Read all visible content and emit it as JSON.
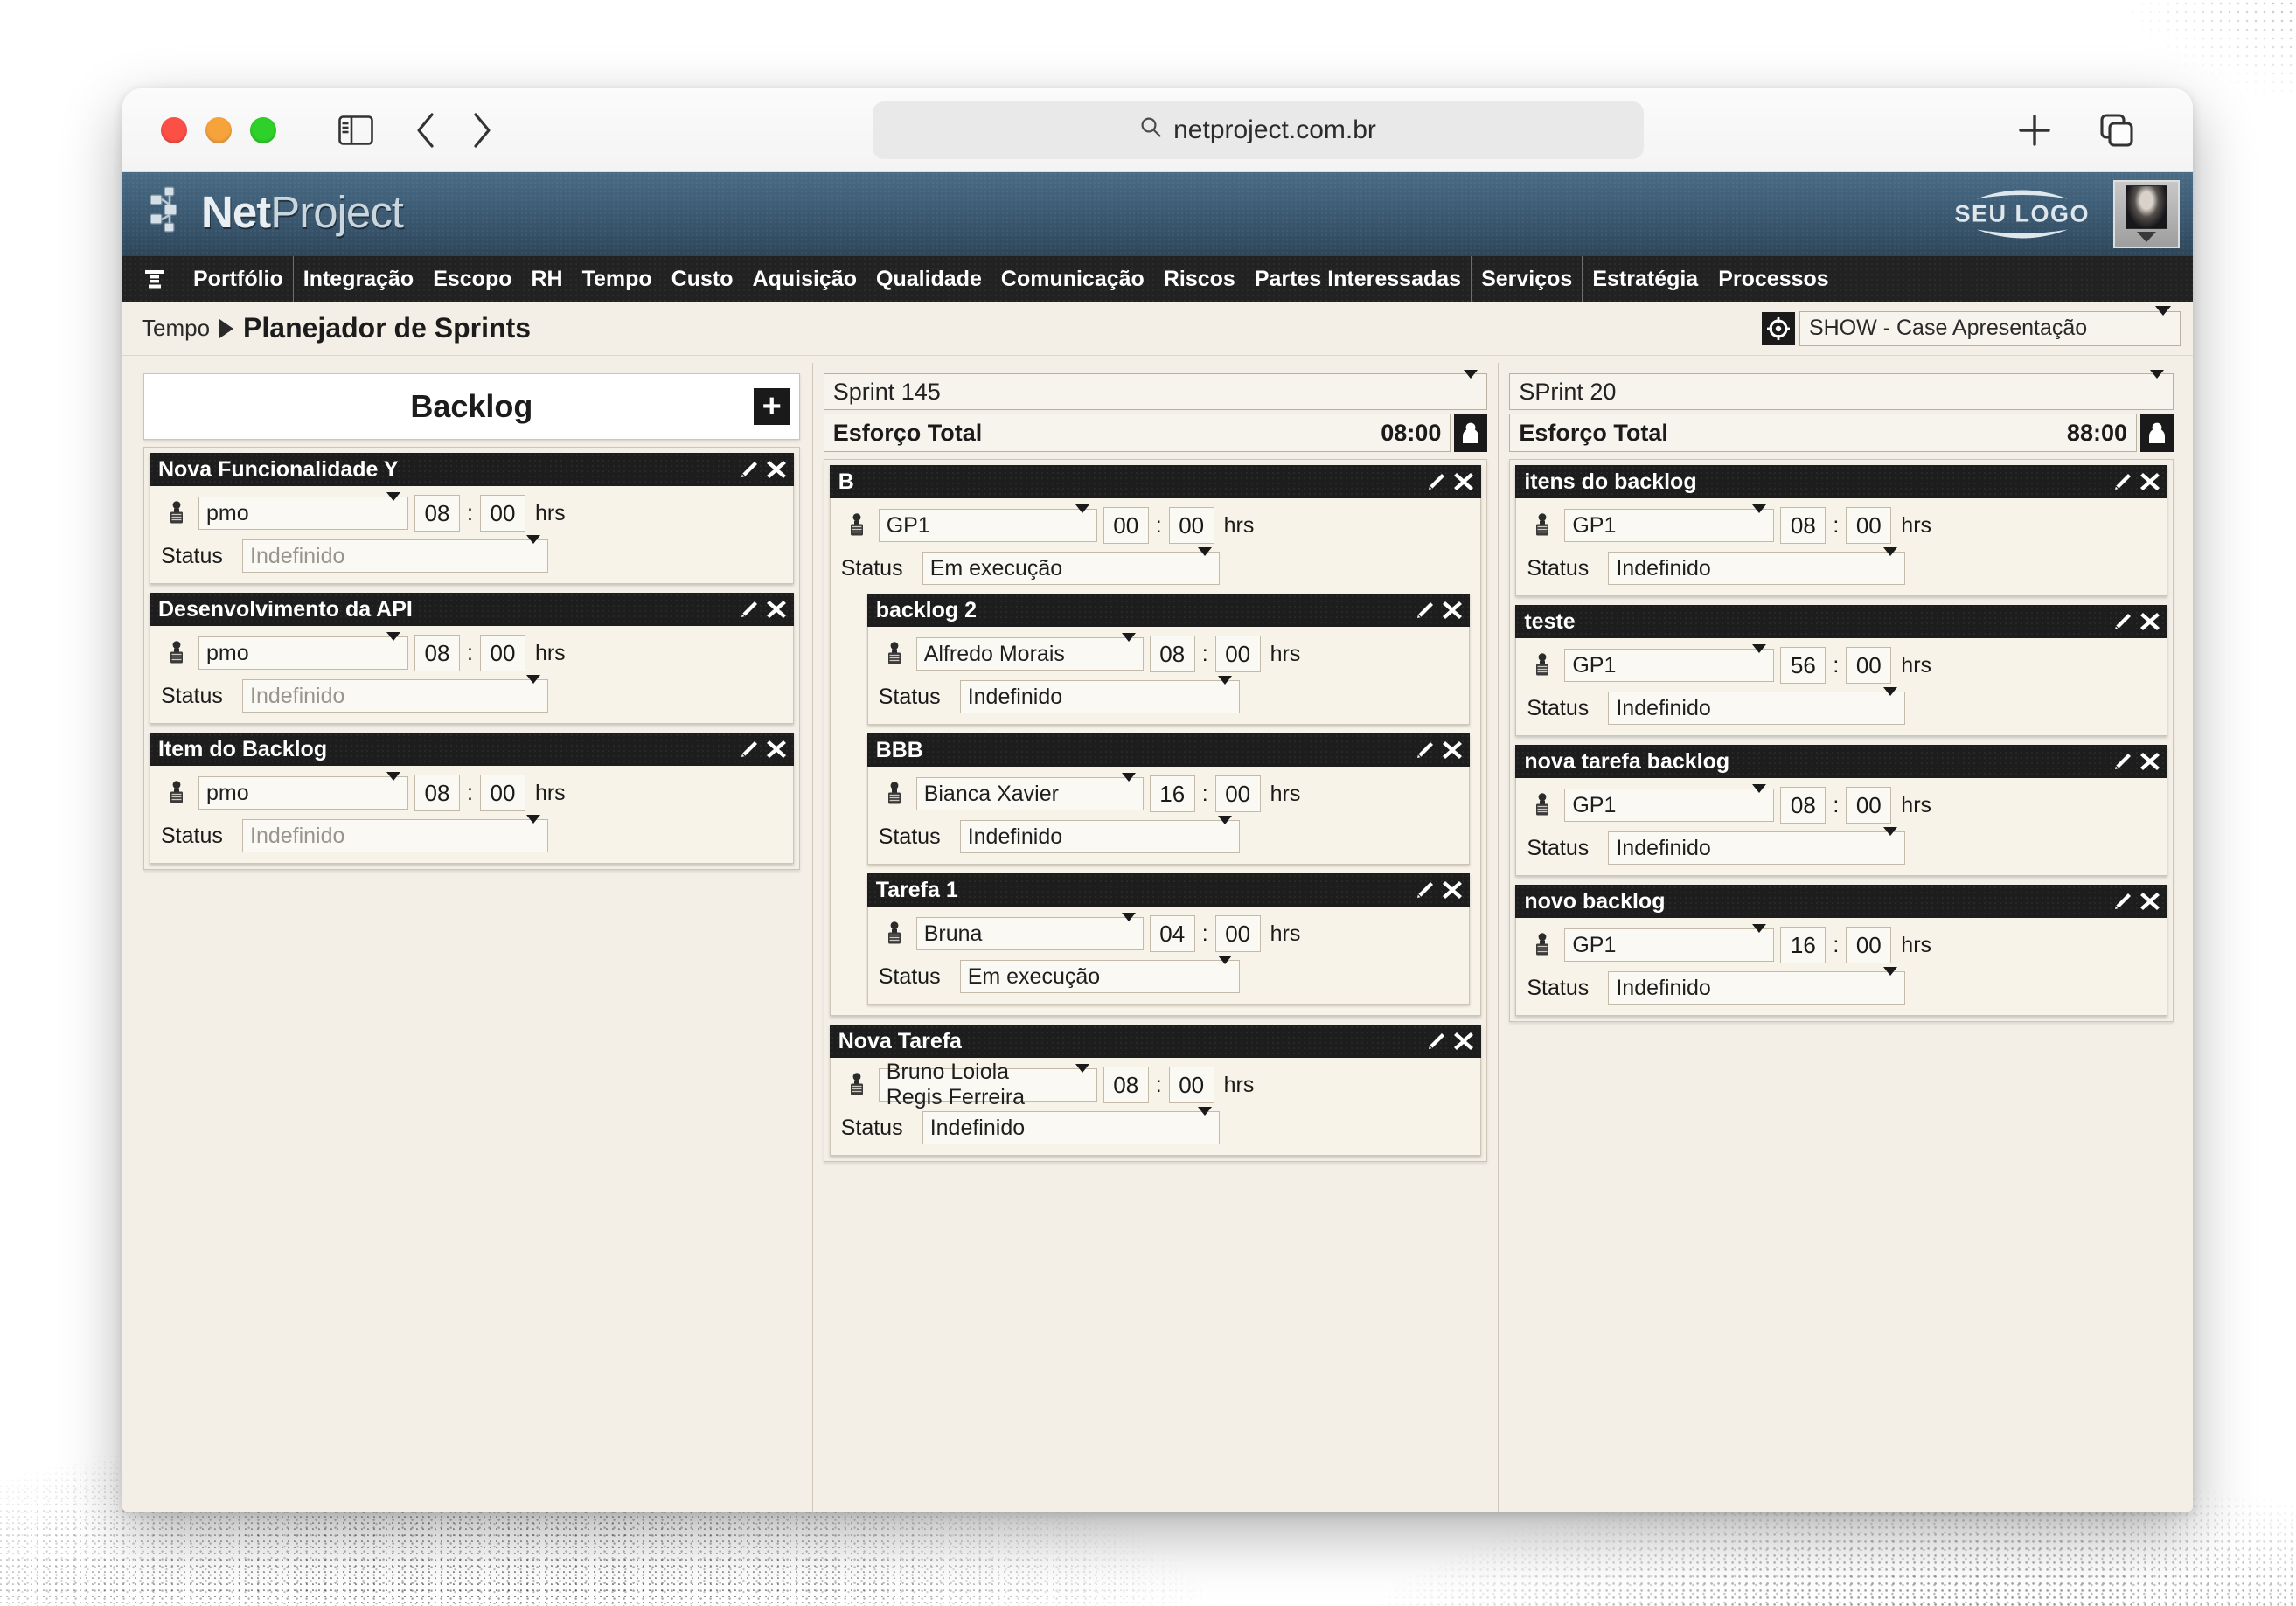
{
  "browser": {
    "url": "netproject.com.br",
    "icons": {
      "search": "search-icon",
      "sidebar": "sidebar-toggle-icon",
      "back": "back-chevron-icon",
      "forward": "forward-chevron-icon",
      "new_tab": "plus-icon",
      "tab_overview": "tab-overview-icon"
    },
    "traffic_lights": [
      "close-button",
      "minimize-button",
      "zoom-button"
    ]
  },
  "app": {
    "logo": {
      "part1": "Net",
      "part2": "Project"
    },
    "brand_logo_text": "SEU LOGO",
    "avatar_label": "user-avatar",
    "nav": [
      {
        "label": "Portfólio",
        "sep": false
      },
      {
        "label": "Integração",
        "sep": true
      },
      {
        "label": "Escopo",
        "sep": false
      },
      {
        "label": "RH",
        "sep": false
      },
      {
        "label": "Tempo",
        "sep": false
      },
      {
        "label": "Custo",
        "sep": false
      },
      {
        "label": "Aquisição",
        "sep": false
      },
      {
        "label": "Qualidade",
        "sep": false
      },
      {
        "label": "Comunicação",
        "sep": false
      },
      {
        "label": "Riscos",
        "sep": false
      },
      {
        "label": "Partes Interessadas",
        "sep": false
      },
      {
        "label": "Serviços",
        "sep": true
      },
      {
        "label": "Estratégia",
        "sep": true
      },
      {
        "label": "Processos",
        "sep": true
      }
    ],
    "breadcrumb": {
      "level1": "Tempo",
      "level2": "Planejador de Sprints"
    },
    "project_selector": {
      "value": "SHOW - Case Apresentação"
    }
  },
  "board": {
    "backlog": {
      "title": "Backlog",
      "add_label": "+",
      "cards": [
        {
          "title": "Nova Funcionalidade Y",
          "assignee": "pmo",
          "hours": "08",
          "minutes": "00",
          "unit": "hrs",
          "status_label": "Status",
          "status_value": "Indefinido",
          "status_muted": true
        },
        {
          "title": "Desenvolvimento da API",
          "assignee": "pmo",
          "hours": "08",
          "minutes": "00",
          "unit": "hrs",
          "status_label": "Status",
          "status_value": "Indefinido",
          "status_muted": true
        },
        {
          "title": "Item do Backlog",
          "assignee": "pmo",
          "hours": "08",
          "minutes": "00",
          "unit": "hrs",
          "status_label": "Status",
          "status_value": "Indefinido",
          "status_muted": true
        }
      ]
    },
    "sprint1": {
      "selector_value": "Sprint 145",
      "effort_label": "Esforço Total",
      "effort_value": "08:00",
      "cards": [
        {
          "title": "B",
          "assignee": "GP1",
          "hours": "00",
          "minutes": "00",
          "unit": "hrs",
          "status_label": "Status",
          "status_value": "Em execução",
          "status_muted": false,
          "children": [
            {
              "title": "backlog 2",
              "assignee": "Alfredo Morais",
              "hours": "08",
              "minutes": "00",
              "unit": "hrs",
              "status_label": "Status",
              "status_value": "Indefinido",
              "status_muted": false
            },
            {
              "title": "BBB",
              "assignee": "Bianca Xavier",
              "hours": "16",
              "minutes": "00",
              "unit": "hrs",
              "status_label": "Status",
              "status_value": "Indefinido",
              "status_muted": false
            },
            {
              "title": "Tarefa 1",
              "assignee": "Bruna",
              "hours": "04",
              "minutes": "00",
              "unit": "hrs",
              "status_label": "Status",
              "status_value": "Em execução",
              "status_muted": false
            }
          ]
        },
        {
          "title": "Nova Tarefa",
          "assignee": "Bruno Loiola Regis Ferreira",
          "hours": "08",
          "minutes": "00",
          "unit": "hrs",
          "status_label": "Status",
          "status_value": "Indefinido",
          "status_muted": false,
          "children": []
        }
      ]
    },
    "sprint2": {
      "selector_value": "SPrint 20",
      "effort_label": "Esforço Total",
      "effort_value": "88:00",
      "cards": [
        {
          "title": "itens do backlog",
          "assignee": "GP1",
          "hours": "08",
          "minutes": "00",
          "unit": "hrs",
          "status_label": "Status",
          "status_value": "Indefinido",
          "status_muted": false
        },
        {
          "title": "teste",
          "assignee": "GP1",
          "hours": "56",
          "minutes": "00",
          "unit": "hrs",
          "status_label": "Status",
          "status_value": "Indefinido",
          "status_muted": false
        },
        {
          "title": "nova tarefa backlog",
          "assignee": "GP1",
          "hours": "08",
          "minutes": "00",
          "unit": "hrs",
          "status_label": "Status",
          "status_value": "Indefinido",
          "status_muted": false
        },
        {
          "title": "novo backlog",
          "assignee": "GP1",
          "hours": "16",
          "minutes": "00",
          "unit": "hrs",
          "status_label": "Status",
          "status_value": "Indefinido",
          "status_muted": false
        }
      ]
    }
  },
  "icons": {
    "edit": "pencil-icon",
    "delete": "close-x-icon",
    "person": "person-icon",
    "effort_person": "person-effort-icon",
    "menu": "hamburger-menu-icon",
    "target": "target-crosshair-icon"
  },
  "colors": {
    "header_blue": "#3d5c75",
    "nav_black": "#222222",
    "card_header": "#1d1d1d",
    "card_body": "#f7f3e9",
    "page_bg": "#f3efe6"
  }
}
